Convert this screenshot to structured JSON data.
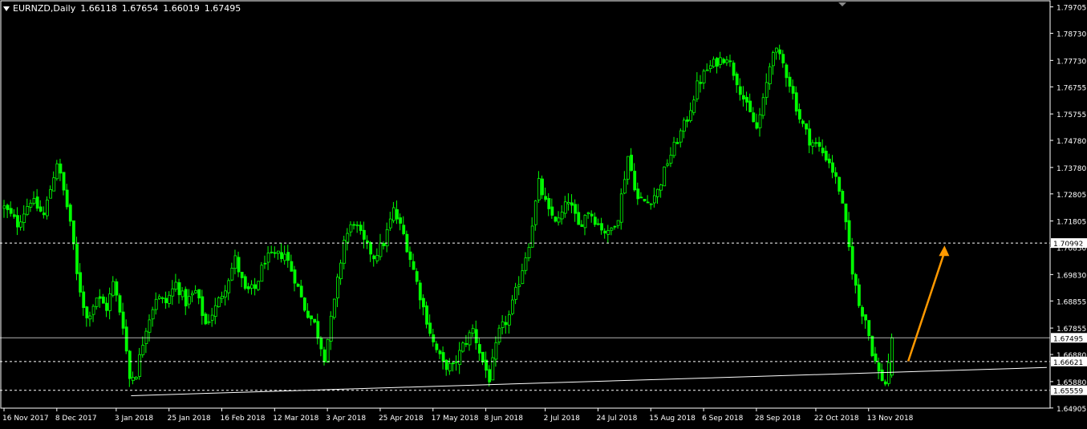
{
  "header": {
    "symbol": "EURNZD,Daily",
    "open": "1.66118",
    "high": "1.67654",
    "low": "1.66019",
    "close": "1.67495"
  },
  "colors": {
    "background": "#000000",
    "candle": "#00ff00",
    "axis": "#ffffff",
    "grid_line": "#ffffff",
    "arrow": "#ff9900",
    "label_bg": "#ffffff",
    "label_text": "#000000"
  },
  "chart_data": {
    "type": "candlestick",
    "title": "EURNZD,Daily",
    "ylim": [
      1.649,
      1.799
    ],
    "y_ticks": [
      "1.79705",
      "1.78730",
      "1.77730",
      "1.76755",
      "1.75755",
      "1.74780",
      "1.73780",
      "1.72805",
      "1.71805",
      "1.70830",
      "1.69830",
      "1.68855",
      "1.67855",
      "1.66880",
      "1.65880",
      "1.64905"
    ],
    "y_tick_values": [
      1.79705,
      1.7873,
      1.7773,
      1.76755,
      1.75755,
      1.7478,
      1.7378,
      1.72805,
      1.71805,
      1.7083,
      1.6983,
      1.68855,
      1.67855,
      1.6688,
      1.6588,
      1.64905
    ],
    "x_tick_labels": [
      "16 Nov 2017",
      "8 Dec 2017",
      "3 Jan 2018",
      "25 Jan 2018",
      "16 Feb 2018",
      "12 Mar 2018",
      "3 Apr 2018",
      "25 Apr 2018",
      "17 May 2018",
      "8 Jun 2018",
      "2 Jul 2018",
      "24 Jul 2018",
      "15 Aug 2018",
      "6 Sep 2018",
      "28 Sep 2018",
      "22 Oct 2018",
      "13 Nov 2018"
    ],
    "x_tick_index": [
      0,
      16,
      34,
      50,
      66,
      82,
      98,
      114,
      130,
      146,
      164,
      180,
      196,
      212,
      228,
      246,
      262
    ],
    "close_path": [
      [
        0,
        1.723
      ],
      [
        4,
        1.717
      ],
      [
        8,
        1.726
      ],
      [
        12,
        1.72
      ],
      [
        16,
        1.74
      ],
      [
        20,
        1.718
      ],
      [
        22,
        1.698
      ],
      [
        25,
        1.682
      ],
      [
        28,
        1.69
      ],
      [
        31,
        1.686
      ],
      [
        33,
        1.695
      ],
      [
        36,
        1.68
      ],
      [
        38,
        1.66
      ],
      [
        40,
        1.662
      ],
      [
        43,
        1.679
      ],
      [
        46,
        1.69
      ],
      [
        49,
        1.688
      ],
      [
        52,
        1.695
      ],
      [
        55,
        1.688
      ],
      [
        58,
        1.692
      ],
      [
        61,
        1.68
      ],
      [
        64,
        1.686
      ],
      [
        67,
        1.694
      ],
      [
        70,
        1.704
      ],
      [
        73,
        1.692
      ],
      [
        76,
        1.693
      ],
      [
        79,
        1.704
      ],
      [
        82,
        1.705
      ],
      [
        85,
        1.706
      ],
      [
        88,
        1.697
      ],
      [
        91,
        1.686
      ],
      [
        94,
        1.68
      ],
      [
        97,
        1.668
      ],
      [
        100,
        1.688
      ],
      [
        103,
        1.711
      ],
      [
        106,
        1.718
      ],
      [
        109,
        1.71
      ],
      [
        112,
        1.705
      ],
      [
        115,
        1.71
      ],
      [
        118,
        1.722
      ],
      [
        121,
        1.713
      ],
      [
        124,
        1.7
      ],
      [
        127,
        1.686
      ],
      [
        130,
        1.673
      ],
      [
        133,
        1.665
      ],
      [
        136,
        1.664
      ],
      [
        139,
        1.672
      ],
      [
        142,
        1.678
      ],
      [
        145,
        1.666
      ],
      [
        147,
        1.66
      ],
      [
        150,
        1.677
      ],
      [
        153,
        1.683
      ],
      [
        156,
        1.696
      ],
      [
        159,
        1.71
      ],
      [
        162,
        1.732
      ],
      [
        165,
        1.721
      ],
      [
        168,
        1.718
      ],
      [
        171,
        1.726
      ],
      [
        174,
        1.716
      ],
      [
        177,
        1.722
      ],
      [
        180,
        1.717
      ],
      [
        183,
        1.713
      ],
      [
        186,
        1.72
      ],
      [
        189,
        1.742
      ],
      [
        192,
        1.726
      ],
      [
        195,
        1.725
      ],
      [
        198,
        1.729
      ],
      [
        201,
        1.74
      ],
      [
        204,
        1.748
      ],
      [
        207,
        1.756
      ],
      [
        210,
        1.768
      ],
      [
        213,
        1.774
      ],
      [
        216,
        1.777
      ],
      [
        219,
        1.779
      ],
      [
        222,
        1.77
      ],
      [
        225,
        1.76
      ],
      [
        228,
        1.752
      ],
      [
        230,
        1.762
      ],
      [
        233,
        1.782
      ],
      [
        236,
        1.776
      ],
      [
        238,
        1.769
      ],
      [
        241,
        1.756
      ],
      [
        244,
        1.748
      ],
      [
        247,
        1.745
      ],
      [
        250,
        1.74
      ],
      [
        253,
        1.73
      ],
      [
        255,
        1.716
      ],
      [
        257,
        1.7
      ],
      [
        259,
        1.687
      ],
      [
        261,
        1.682
      ],
      [
        263,
        1.67
      ],
      [
        265,
        1.662
      ],
      [
        267,
        1.658
      ],
      [
        269,
        1.6748
      ]
    ],
    "last_index": 270,
    "h_lines": [
      {
        "value": 1.70992,
        "label": "1.70992",
        "style": "dashed"
      },
      {
        "value": 1.67495,
        "label": "1.67495",
        "style": "solid"
      },
      {
        "value": 1.66621,
        "label": "1.66621",
        "style": "dashed"
      },
      {
        "value": 1.65559,
        "label": "1.65559",
        "style": "dashed"
      }
    ],
    "trendline": {
      "x1": 38.5,
      "y1": 1.6536,
      "x2": 316,
      "y2": 1.664
    },
    "arrow": {
      "x1": 274,
      "y1": 1.6663,
      "x2": 285,
      "y2": 1.709
    }
  }
}
